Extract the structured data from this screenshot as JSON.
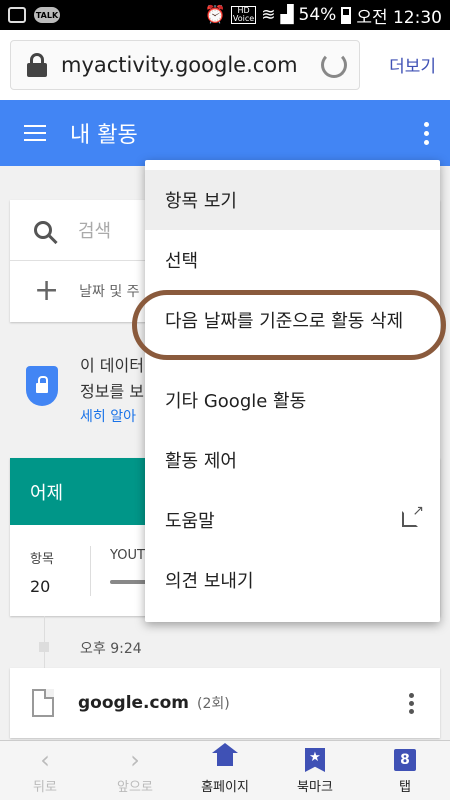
{
  "status_bar": {
    "hd_label": "HD",
    "voice_label": "Voice",
    "talk_label": "TALK",
    "battery": "54%",
    "time": "오전 12:30"
  },
  "browser": {
    "url": "myactivity.google.com",
    "more_label": "더보기"
  },
  "app_bar": {
    "title": "내 활동"
  },
  "search": {
    "placeholder": "검색",
    "filter_label": "날짜 및 주"
  },
  "privacy": {
    "line1": "이 데이터",
    "line2": "정보를 보",
    "link": "세히 알아"
  },
  "day_card": {
    "header": "어제",
    "items_label": "항목",
    "items_count": "20",
    "youtube_label": "YOUTU"
  },
  "timeline": {
    "time": "오후 9:24"
  },
  "entry": {
    "title": "google.com",
    "count": "(2회)"
  },
  "menu": {
    "items": [
      {
        "label": "항목 보기"
      },
      {
        "label": "선택"
      },
      {
        "label": "다음 날짜를 기준으로 활동 삭제"
      },
      {
        "label": "기타 Google 활동"
      },
      {
        "label": "활동 제어"
      },
      {
        "label": "도움말"
      },
      {
        "label": "의견 보내기"
      }
    ]
  },
  "bottom_nav": {
    "back": "뒤로",
    "forward": "앞으로",
    "home": "홈페이지",
    "bookmark": "북마크",
    "tabs": "탭",
    "tab_count": "8"
  },
  "colors": {
    "app_bar": "#4285f4",
    "day_header": "#009688",
    "annotation": "#8a5a3c",
    "accent": "#3f51b5"
  }
}
